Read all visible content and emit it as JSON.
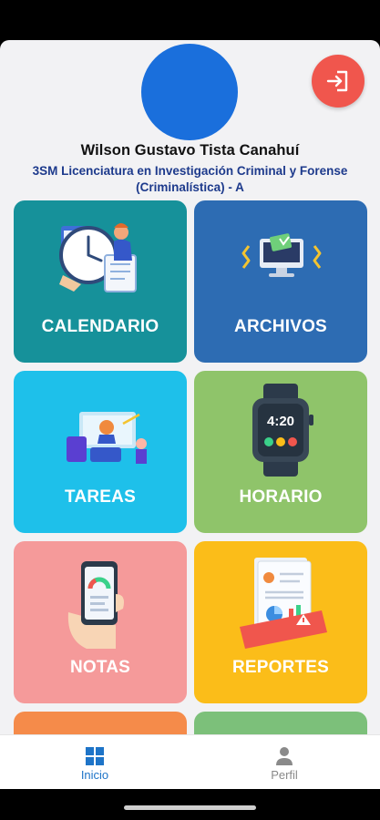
{
  "profile": {
    "name": "Wilson Gustavo Tista Canahuí",
    "career_line1": "3SM Licenciatura en Investigación Criminal y Forense",
    "career_line2": "(Criminalística) - A",
    "avatar_color": "#1a6fdc"
  },
  "logout": {
    "icon": "logout-icon",
    "color": "#f0564d"
  },
  "menu": [
    {
      "label": "CALENDARIO",
      "color": "#16919a",
      "icon": "calendar-clock-illustration"
    },
    {
      "label": "ARCHIVOS",
      "color": "#2d6cb3",
      "icon": "files-illustration"
    },
    {
      "label": "TAREAS",
      "color": "#1ec0ea",
      "icon": "tasks-illustration"
    },
    {
      "label": "HORARIO",
      "color": "#8fc46a",
      "icon": "smartwatch-illustration"
    },
    {
      "label": "NOTAS",
      "color": "#f59a9a",
      "icon": "grades-phone-illustration"
    },
    {
      "label": "REPORTES",
      "color": "#fbbd19",
      "icon": "report-illustration"
    }
  ],
  "watch_time": "4:20",
  "bottom_nav": {
    "home_label": "Inicio",
    "profile_label": "Perfil",
    "active_color": "#1e74c8",
    "inactive_color": "#8a8a8a"
  }
}
